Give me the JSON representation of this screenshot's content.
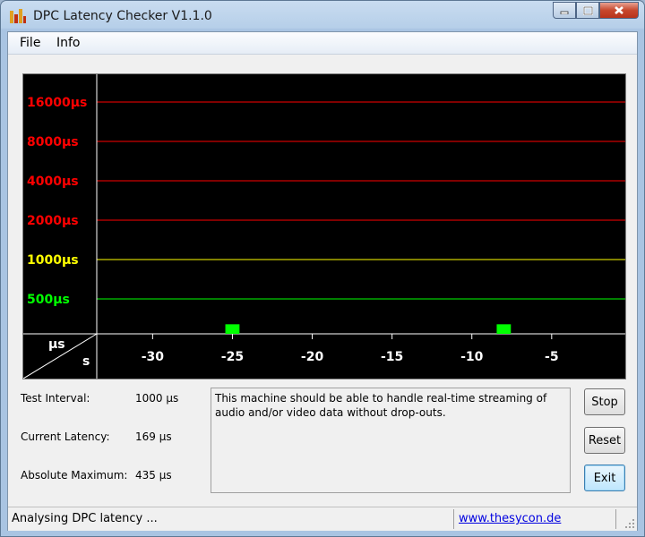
{
  "window": {
    "title": "DPC Latency Checker V1.1.0"
  },
  "menu": {
    "items": [
      "File",
      "Info"
    ]
  },
  "chart_data": {
    "type": "bar",
    "y_scale": "log2",
    "y_ticks": [
      {
        "label": "16000µs",
        "value": 16000,
        "color": "#ff0000"
      },
      {
        "label": "8000µs",
        "value": 8000,
        "color": "#ff0000"
      },
      {
        "label": "4000µs",
        "value": 4000,
        "color": "#ff0000"
      },
      {
        "label": "2000µs",
        "value": 2000,
        "color": "#ff0000"
      },
      {
        "label": "1000µs",
        "value": 1000,
        "color": "#ffff00"
      },
      {
        "label": "500µs",
        "value": 500,
        "color": "#00ff00"
      }
    ],
    "x_ticks": [
      {
        "label": "-30",
        "value": -30
      },
      {
        "label": "-25",
        "value": -25
      },
      {
        "label": "-20",
        "value": -20
      },
      {
        "label": "-15",
        "value": -15
      },
      {
        "label": "-10",
        "value": -10
      },
      {
        "label": "-5",
        "value": -5
      }
    ],
    "xlim": [
      -33,
      0
    ],
    "corner_top": "µs",
    "corner_bottom": "s",
    "bar_color": "#00ff00",
    "x": [
      -33,
      -32,
      -31,
      -30,
      -29,
      -28,
      -27,
      -26,
      -25,
      -24,
      -23,
      -22,
      -21,
      -20,
      -19,
      -18,
      -17,
      -16,
      -15,
      -14,
      -13,
      -12,
      -11,
      -10,
      -9,
      -8,
      -7,
      -6,
      -5,
      -4,
      -3,
      -2,
      -1
    ],
    "values": [
      165,
      160,
      180,
      170,
      180,
      200,
      180,
      160,
      320,
      170,
      155,
      160,
      170,
      160,
      235,
      155,
      220,
      175,
      210,
      170,
      165,
      165,
      165,
      195,
      200,
      320,
      165,
      195,
      165,
      155,
      140,
      145,
      155
    ]
  },
  "info": {
    "rows": [
      {
        "label": "Test Interval:",
        "value": "1000 µs"
      },
      {
        "label": "Current Latency:",
        "value": "169 µs"
      },
      {
        "label": "Absolute Maximum:",
        "value": "435 µs"
      }
    ]
  },
  "message": "This machine should be able to handle real-time streaming of audio and/or video data without drop-outs.",
  "buttons": {
    "stop": "Stop",
    "reset": "Reset",
    "exit": "Exit"
  },
  "status": {
    "text": "Analysing DPC latency ...",
    "link": "www.thesycon.de"
  }
}
